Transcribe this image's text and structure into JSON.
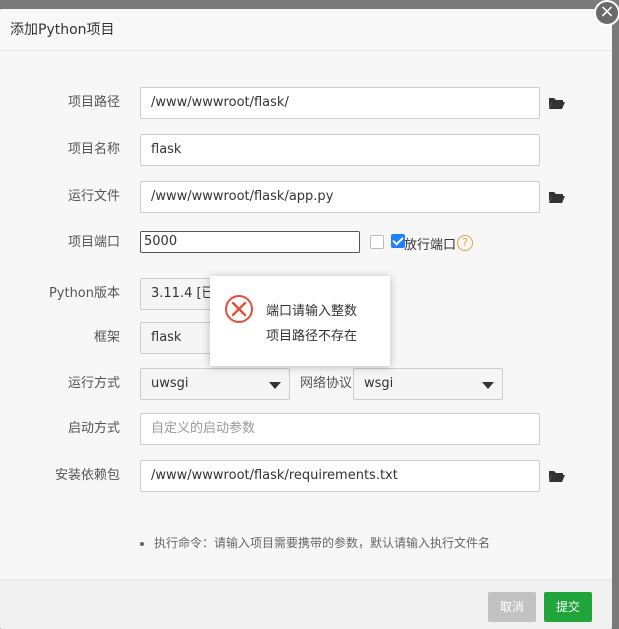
{
  "dialog": {
    "title": "添加Python项目",
    "close_label": "×"
  },
  "form": {
    "project_path": {
      "label": "项目路径",
      "value": "/www/wwwroot/flask/"
    },
    "project_name": {
      "label": "项目名称",
      "value": "flask"
    },
    "run_file": {
      "label": "运行文件",
      "value": "/www/wwwroot/flask/app.py"
    },
    "project_port": {
      "label": "项目端口",
      "value": "5000",
      "release_label": "放行端口",
      "release_checked": true,
      "help": "?"
    },
    "python_version": {
      "label": "Python版本",
      "value": "3.11.4 [已安装]"
    },
    "framework": {
      "label": "框架",
      "value": "flask"
    },
    "run_mode": {
      "label": "运行方式",
      "value": "uwsgi"
    },
    "protocol": {
      "label": "网络协议",
      "value": "wsgi"
    },
    "start_mode": {
      "label": "启动方式",
      "placeholder": "自定义的启动参数"
    },
    "requirements": {
      "label": "安装依赖包",
      "value": "/www/wwwroot/flask/requirements.txt"
    }
  },
  "hint": "执行命令：请输入项目需要携带的参数，默认请输入执行文件名",
  "footer": {
    "cancel_label": "取消",
    "submit_label": "提交"
  },
  "toast": {
    "line1": "端口请输入整数",
    "line2": "项目路径不存在"
  },
  "colors": {
    "submit": "#20a53a",
    "cancel": "#c2c2c2",
    "error": "#e74c3c",
    "help": "#e6a23c"
  }
}
